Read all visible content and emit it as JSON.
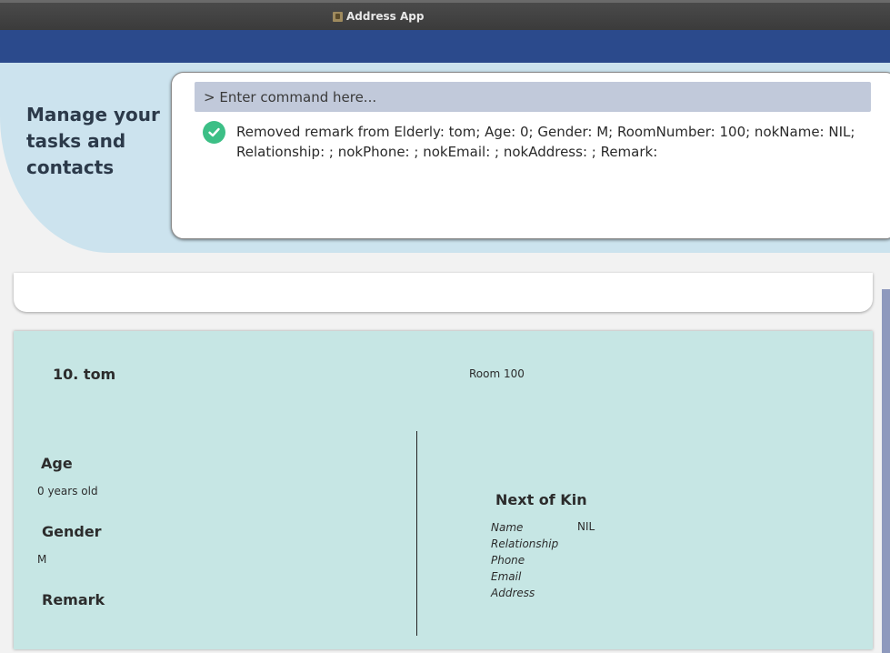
{
  "window": {
    "title": "Address App"
  },
  "header": {
    "tagline": "Manage your tasks and contacts"
  },
  "command": {
    "placeholder": "> Enter command here...",
    "value": "",
    "result": "Removed remark from Elderly: tom; Age: 0; Gender: M; RoomNumber: 100; nokName: NIL; Relationship: ; nokPhone: ; nokEmail: ; nokAddress: ; Remark:",
    "result_status": "success"
  },
  "elderly_card": {
    "name": "10. tom",
    "room": "Room 100",
    "age_label": "Age",
    "age_value": "0 years old",
    "gender_label": "Gender",
    "gender_value": "M",
    "remark_label": "Remark",
    "remark_value": "",
    "nok": {
      "title": "Next of Kin",
      "name_label": "Name",
      "name_value": "NIL",
      "relationship_label": "Relationship",
      "relationship_value": "",
      "phone_label": "Phone",
      "phone_value": "",
      "email_label": "Email",
      "email_value": "",
      "address_label": "Address",
      "address_value": ""
    }
  },
  "colors": {
    "menubar": "#2b4a8c",
    "header_bg": "#cce3ee",
    "card_bg": "#c6e6e4",
    "success": "#3cbf86",
    "command_input_bg": "#c1c9da"
  }
}
